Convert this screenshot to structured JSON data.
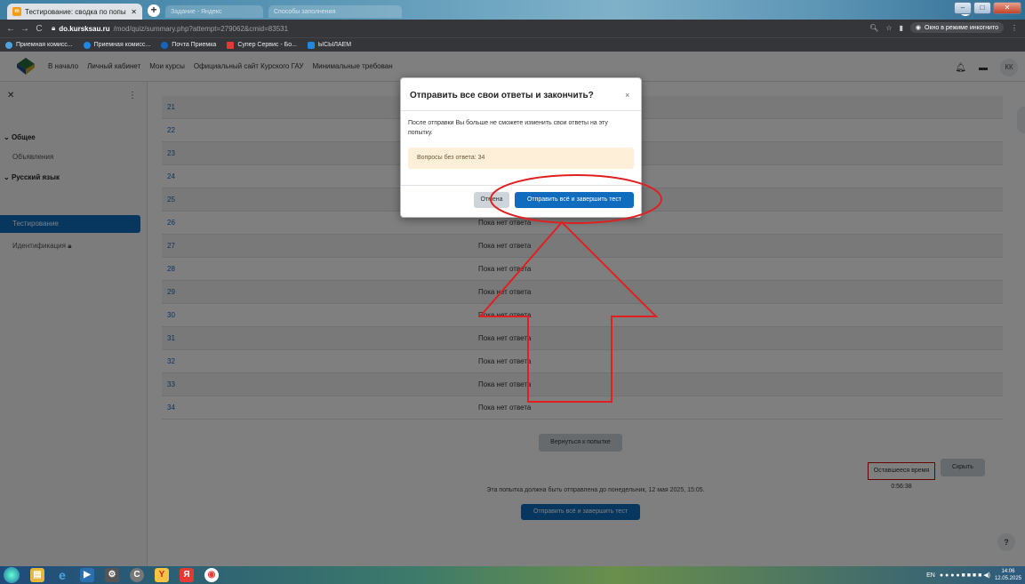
{
  "browser": {
    "active_tab_title": "Тестирование: сводка по попы",
    "inactive_tabs": [
      "Задание - Яндекс",
      "Способы заполнения"
    ],
    "url_host": "do.kursksau.ru",
    "url_path": "/mod/quiz/summary.php?attempt=279062&cmid=83531",
    "incognito_label": "Окно в режиме инкогнито",
    "bookmarks": [
      {
        "label": "Приемная комисс...",
        "color": "#4aa3df"
      },
      {
        "label": "Приемная комисс...",
        "color": "#1e88e5"
      },
      {
        "label": "Почта Приемка",
        "color": "#1565c0"
      },
      {
        "label": "Супер Сервис - Бо...",
        "color": "#e53935"
      },
      {
        "label": "ЫСЫЛАЕМ",
        "color": "#1e88e5"
      }
    ]
  },
  "site_nav": {
    "links": [
      "В начало",
      "Личный кабинет",
      "Мои курсы",
      "Официальный сайт Курского ГАУ",
      "Минимальные требован"
    ],
    "user_initials": "КК"
  },
  "sidebar": {
    "section_general": "Общее",
    "item_announcements": "Объявления",
    "section_course": "Русский язык",
    "item_testing": "Тестирование",
    "item_identification": "Идентификация"
  },
  "questions": [
    {
      "num": "21",
      "status": ""
    },
    {
      "num": "22",
      "status": ""
    },
    {
      "num": "23",
      "status": ""
    },
    {
      "num": "24",
      "status": ""
    },
    {
      "num": "25",
      "status": ""
    },
    {
      "num": "26",
      "status": "Пока нет ответа"
    },
    {
      "num": "27",
      "status": "Пока нет ответа"
    },
    {
      "num": "28",
      "status": "Пока нет ответа"
    },
    {
      "num": "29",
      "status": "Пока нет ответа"
    },
    {
      "num": "30",
      "status": "Пока нет ответа"
    },
    {
      "num": "31",
      "status": "Пока нет ответа"
    },
    {
      "num": "32",
      "status": "Пока нет ответа"
    },
    {
      "num": "33",
      "status": "Пока нет ответа"
    },
    {
      "num": "34",
      "status": "Пока нет ответа"
    }
  ],
  "page": {
    "return_button": "Вернуться к попытке",
    "timer_label": "Оставшееся время 0:56:38",
    "hide_button": "Скрыть",
    "deadline_text": "Эта попытка должна быть отправлена до понедельник, 12 мая 2025, 15:05.",
    "submit_button": "Отправить всё и завершить тест",
    "help": "?"
  },
  "modal": {
    "title": "Отправить все свои ответы и закончить?",
    "close": "×",
    "body": "После отправки Вы больше не сможете изменить свои ответы на эту попытку.",
    "alert": "Вопросы без ответа: 34",
    "cancel": "Отмена",
    "submit": "Отправить всё и завершить тест"
  },
  "taskbar": {
    "lang": "EN",
    "time": "14:06",
    "date": "12.05.2025"
  },
  "colors": {
    "primary": "#0f6cbf",
    "annotation": "#e02020",
    "alert_bg": "#fdefd8"
  }
}
